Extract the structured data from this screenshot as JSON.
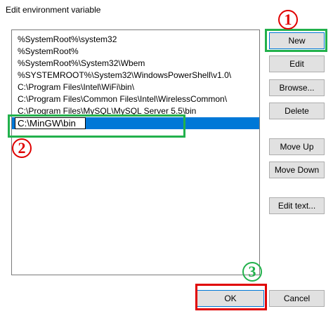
{
  "window": {
    "title": "Edit environment variable"
  },
  "paths": [
    "%SystemRoot%\\system32",
    "%SystemRoot%",
    "%SystemRoot%\\System32\\Wbem",
    "%SYSTEMROOT%\\System32\\WindowsPowerShell\\v1.0\\",
    "C:\\Program Files\\Intel\\WiFi\\bin\\",
    "C:\\Program Files\\Common Files\\Intel\\WirelessCommon\\",
    "C:\\Program Files\\MySQL\\MySQL Server 5.5\\bin"
  ],
  "editing_value": "C:\\MinGW\\bin",
  "buttons": {
    "new": "New",
    "edit": "Edit",
    "browse": "Browse...",
    "delete": "Delete",
    "move_up": "Move Up",
    "move_down": "Move Down",
    "edit_text": "Edit text...",
    "ok": "OK",
    "cancel": "Cancel"
  },
  "annotations": {
    "step1": "1",
    "step2": "2",
    "step3": "3"
  },
  "colors": {
    "selection": "#0078d7",
    "annotation_red": "#e00000",
    "annotation_green": "#22b14c"
  }
}
